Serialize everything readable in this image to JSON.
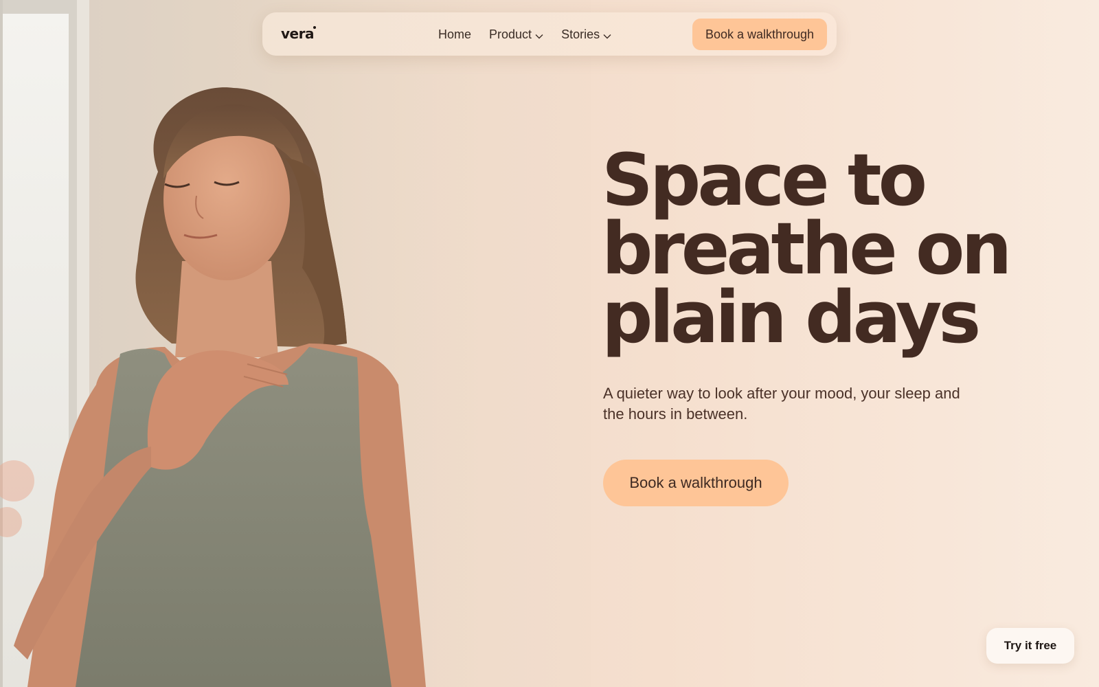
{
  "brand": {
    "name": "vera"
  },
  "nav": {
    "links": [
      {
        "label": "Home",
        "has_dropdown": false
      },
      {
        "label": "Product",
        "has_dropdown": true
      },
      {
        "label": "Stories",
        "has_dropdown": true
      }
    ],
    "cta_label": "Book a walkthrough"
  },
  "hero": {
    "headline_lines": [
      "Space to",
      "breathe on",
      "plain days"
    ],
    "subcopy": "A quieter way to look after your mood, your sleep and the hours in between.",
    "cta_label": "Book a walkthrough"
  },
  "floating": {
    "try_label": "Try it free"
  },
  "colors": {
    "accent": "#fec597",
    "headline": "#432b22",
    "background": "#f5dfce"
  },
  "icons": {
    "dropdown": "chevron-down-icon"
  }
}
